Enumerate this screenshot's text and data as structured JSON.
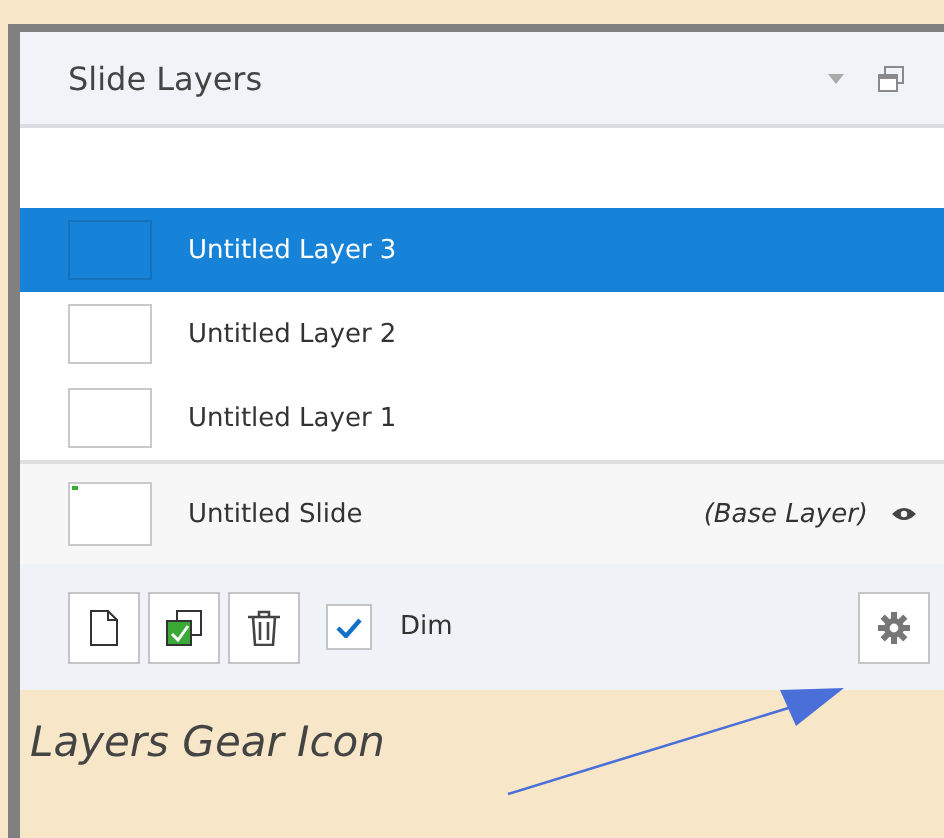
{
  "panel": {
    "title": "Slide Layers",
    "layers": [
      {
        "name": "Untitled Layer 3",
        "selected": true
      },
      {
        "name": "Untitled Layer 2",
        "selected": false
      },
      {
        "name": "Untitled Layer 1",
        "selected": false
      }
    ],
    "base": {
      "name": "Untitled Slide",
      "note": "(Base Layer)"
    },
    "dim": {
      "label": "Dim",
      "checked": true
    }
  },
  "annotation": {
    "text": "Layers Gear Icon"
  }
}
